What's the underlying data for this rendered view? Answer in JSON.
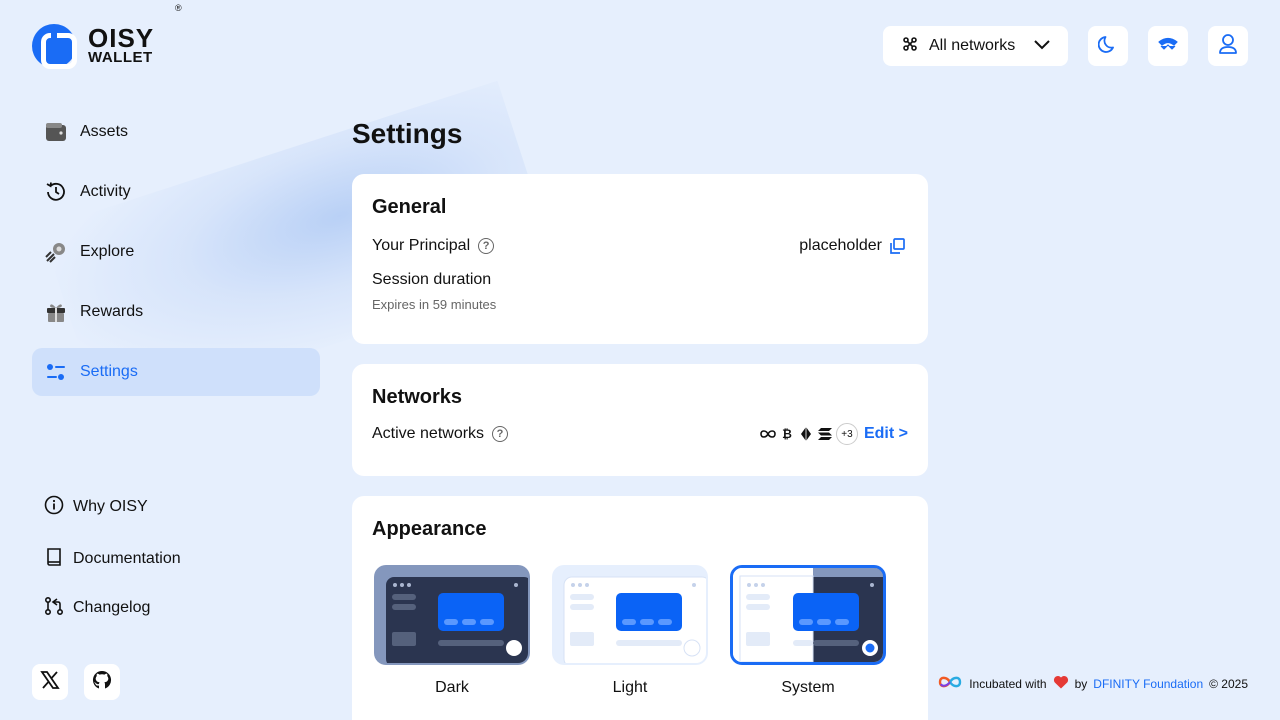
{
  "brand": {
    "line1": "OISY",
    "line2": "WALLET",
    "reg": "®"
  },
  "topbar": {
    "network_selector": "All networks",
    "buttons": [
      {
        "icon": "moon-icon"
      },
      {
        "icon": "walletconnect-icon"
      },
      {
        "icon": "user-icon"
      }
    ]
  },
  "sidebar": {
    "items": [
      {
        "label": "Assets",
        "icon": "wallet-icon"
      },
      {
        "label": "Activity",
        "icon": "history-icon"
      },
      {
        "label": "Explore",
        "icon": "explore-icon"
      },
      {
        "label": "Rewards",
        "icon": "gift-icon"
      },
      {
        "label": "Settings",
        "icon": "settings-icon",
        "active": true
      }
    ],
    "links": [
      {
        "label": "Why OISY",
        "icon": "info-icon"
      },
      {
        "label": "Documentation",
        "icon": "book-icon"
      },
      {
        "label": "Changelog",
        "icon": "changelog-icon"
      }
    ],
    "social": [
      {
        "icon": "x-icon"
      },
      {
        "icon": "github-icon"
      }
    ]
  },
  "main": {
    "title": "Settings",
    "general": {
      "heading": "General",
      "principal_label": "Your Principal",
      "principal_value": "placeholder",
      "session_label": "Session duration",
      "session_expiry": "Expires in 59 minutes"
    },
    "networks": {
      "heading": "Networks",
      "active_label": "Active networks",
      "more_count": "+3",
      "edit_label": "Edit >"
    },
    "appearance": {
      "heading": "Appearance",
      "themes": [
        {
          "label": "Dark"
        },
        {
          "label": "Light"
        },
        {
          "label": "System",
          "selected": true
        }
      ]
    }
  },
  "footer": {
    "incubated": "Incubated with",
    "by": "by",
    "foundation": "DFINITY Foundation",
    "copyright": "© 2025"
  },
  "colors": {
    "accent": "#1a6cf5",
    "background": "#e6effd",
    "active_nav": "#cfe0fb"
  }
}
